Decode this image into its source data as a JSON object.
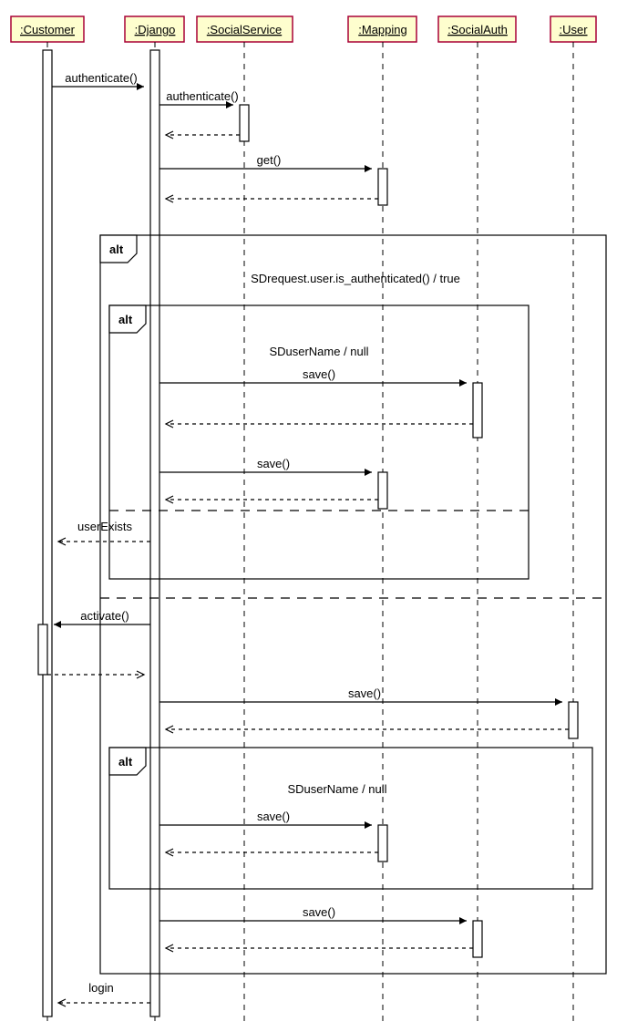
{
  "participants": {
    "customer": ":Customer",
    "django": ":Django",
    "socialservice": ":SocialService",
    "mapping": ":Mapping",
    "socialauth": ":SocialAuth",
    "user": ":User"
  },
  "messages": {
    "m1": "authenticate()",
    "m2": "authenticate()",
    "m3": "get()",
    "m4": "save()",
    "m5": "save()",
    "m6": "userExists",
    "m7": "activate()",
    "m8": "save()",
    "m9": "save()",
    "m10": "save()",
    "m11": "login"
  },
  "fragments": {
    "alt_label": "alt",
    "guard_outer": "SDrequest.user.is_authenticated() / true",
    "guard_inner1": "SDuserName / null",
    "guard_inner2": "SDuserName / null"
  }
}
